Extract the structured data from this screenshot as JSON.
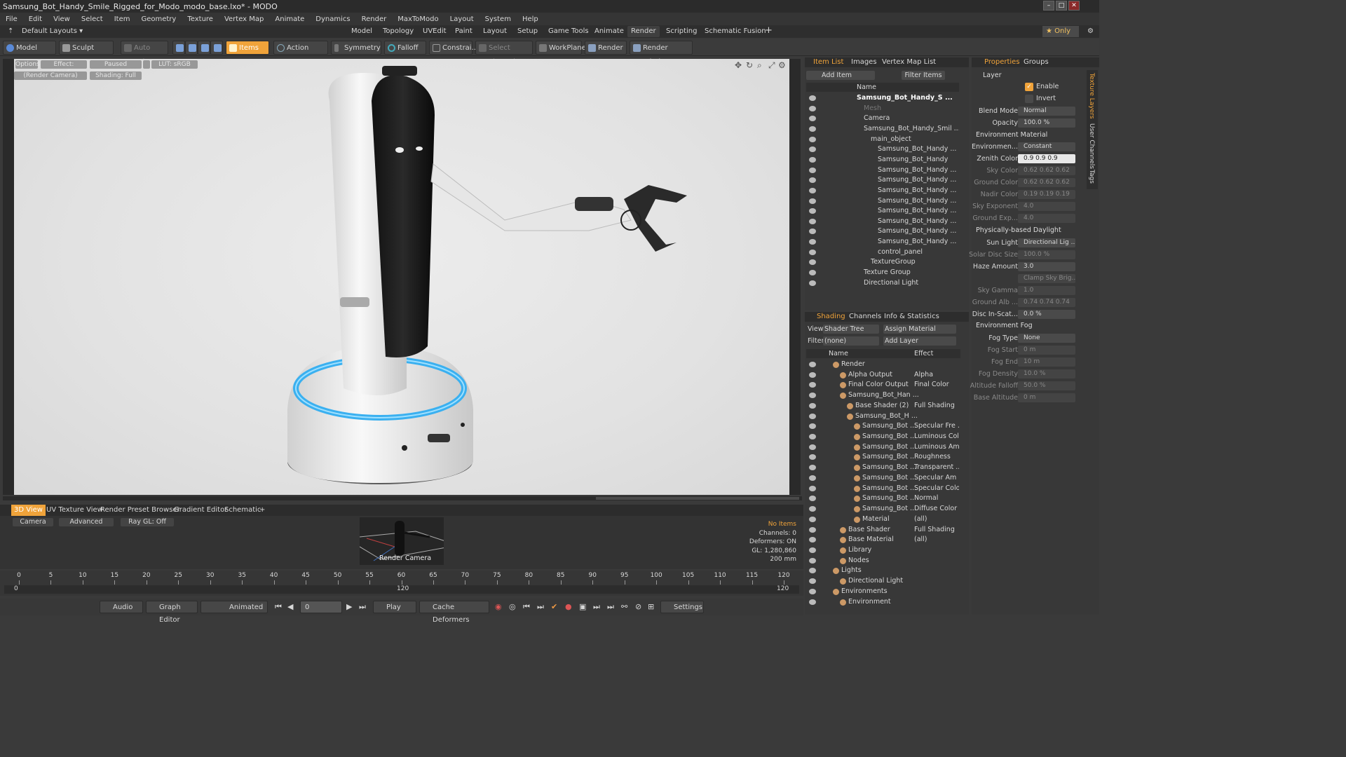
{
  "window": {
    "title": "Samsung_Bot_Handy_Smile_Rigged_for_Modo_modo_base.lxo* - MODO"
  },
  "menu": [
    "File",
    "Edit",
    "View",
    "Select",
    "Item",
    "Geometry",
    "Texture",
    "Vertex Map",
    "Animate",
    "Dynamics",
    "Render",
    "MaxToModo",
    "Layout",
    "System",
    "Help"
  ],
  "layout": {
    "preset": "Default Layouts ▾",
    "tabs": [
      "Model",
      "Topology",
      "UVEdit",
      "Paint",
      "Layout",
      "Setup",
      "Game Tools",
      "Animate",
      "Render",
      "Scripting",
      "Schematic Fusion"
    ],
    "active": "Render",
    "only": "★ Only",
    "add": "+"
  },
  "toolbar": {
    "model": "Model",
    "sculpt": "Sculpt",
    "auto_select": "Auto Select",
    "items": "Items",
    "action_center": "Action Center",
    "symmetry": "Symmetry",
    "falloff": "Falloff",
    "constrain": "Constrai...",
    "select_through": "Select Through",
    "workplane": "WorkPlane",
    "render": "Render",
    "render_window": "Render Window"
  },
  "viewport": {
    "options": "Options",
    "effect": "Effect: (Shadi...",
    "paused": "Paused",
    "lut": "LUT: sRGB",
    "camera": "(Render Camera)",
    "shading": "Shading: Full"
  },
  "item_list": {
    "tabs": [
      "Item List",
      "Images",
      "Vertex Map List"
    ],
    "add_item": "Add Item",
    "filter_items": "Filter Items",
    "col_name": "Name",
    "items": [
      {
        "label": "Samsung_Bot_Handy_S ...",
        "indent": 0,
        "bold": true
      },
      {
        "label": "Mesh",
        "indent": 1,
        "dim": true
      },
      {
        "label": "Camera",
        "indent": 1
      },
      {
        "label": "Samsung_Bot_Handy_Smil ...",
        "indent": 1
      },
      {
        "label": "main_object",
        "indent": 2
      },
      {
        "label": "Samsung_Bot_Handy ...",
        "indent": 3
      },
      {
        "label": "Samsung_Bot_Handy",
        "indent": 3
      },
      {
        "label": "Samsung_Bot_Handy ...",
        "indent": 3
      },
      {
        "label": "Samsung_Bot_Handy ...",
        "indent": 3
      },
      {
        "label": "Samsung_Bot_Handy ...",
        "indent": 3
      },
      {
        "label": "Samsung_Bot_Handy ...",
        "indent": 3
      },
      {
        "label": "Samsung_Bot_Handy ...",
        "indent": 3
      },
      {
        "label": "Samsung_Bot_Handy ...",
        "indent": 3
      },
      {
        "label": "Samsung_Bot_Handy ...",
        "indent": 3
      },
      {
        "label": "Samsung_Bot_Handy ...",
        "indent": 3
      },
      {
        "label": "control_panel",
        "indent": 3
      },
      {
        "label": "TextureGroup",
        "indent": 2
      },
      {
        "label": "Texture Group",
        "indent": 1
      },
      {
        "label": "Directional Light",
        "indent": 1
      }
    ]
  },
  "shading": {
    "tabs": [
      "Shading",
      "Channels",
      "Info & Statistics"
    ],
    "view_label": "View",
    "view_value": "Shader Tree",
    "assign": "Assign Material",
    "filter_label": "Filter",
    "filter_value": "(none)",
    "add_layer": "Add Layer",
    "col_name": "Name",
    "col_effect": "Effect",
    "rows": [
      {
        "name": "Render",
        "effect": "",
        "indent": 0
      },
      {
        "name": "Alpha Output",
        "effect": "Alpha",
        "indent": 1
      },
      {
        "name": "Final Color Output",
        "effect": "Final Color",
        "indent": 1
      },
      {
        "name": "Samsung_Bot_Han ...",
        "effect": "",
        "indent": 1
      },
      {
        "name": "Base Shader (2)",
        "effect": "Full Shading",
        "indent": 2
      },
      {
        "name": "Samsung_Bot_H ...",
        "effect": "",
        "indent": 2
      },
      {
        "name": "Samsung_Bot ...",
        "effect": "Specular Fre ...",
        "indent": 3
      },
      {
        "name": "Samsung_Bot ...",
        "effect": "Luminous Col ...",
        "indent": 3
      },
      {
        "name": "Samsung_Bot ...",
        "effect": "Luminous Am ...",
        "indent": 3
      },
      {
        "name": "Samsung_Bot ...",
        "effect": "Roughness",
        "indent": 3
      },
      {
        "name": "Samsung_Bot ...",
        "effect": "Transparent ...",
        "indent": 3
      },
      {
        "name": "Samsung_Bot ...",
        "effect": "Specular Am ...",
        "indent": 3
      },
      {
        "name": "Samsung_Bot ...",
        "effect": "Specular Color",
        "indent": 3
      },
      {
        "name": "Samsung_Bot ...",
        "effect": "Normal",
        "indent": 3
      },
      {
        "name": "Samsung_Bot ...",
        "effect": "Diffuse Color",
        "indent": 3
      },
      {
        "name": "Material",
        "effect": "(all)",
        "indent": 3
      },
      {
        "name": "Base Shader",
        "effect": "Full Shading",
        "indent": 1
      },
      {
        "name": "Base Material",
        "effect": "(all)",
        "indent": 1
      },
      {
        "name": "Library",
        "effect": "",
        "indent": 1
      },
      {
        "name": "Nodes",
        "effect": "",
        "indent": 1
      },
      {
        "name": "Lights",
        "effect": "",
        "indent": 0
      },
      {
        "name": "Directional Light",
        "effect": "",
        "indent": 1
      },
      {
        "name": "Environments",
        "effect": "",
        "indent": 0
      },
      {
        "name": "Environment",
        "effect": "",
        "indent": 1
      }
    ]
  },
  "properties": {
    "tabs": [
      "Properties",
      "Groups"
    ],
    "side_tabs": [
      "Texture Layers",
      "User Channels",
      "Tags"
    ],
    "layer": "Layer",
    "enable": "Enable",
    "invert": "Invert",
    "fields": [
      {
        "label": "Blend Mode",
        "value": "Normal"
      },
      {
        "label": "Opacity",
        "value": "100.0 %"
      }
    ],
    "env_material": "Environment Material",
    "env_fields": [
      {
        "label": "Environmen...",
        "value": "Constant",
        "dim": false
      },
      {
        "label": "Zenith Color",
        "value": "0.9   0.9   0.9",
        "dim": false,
        "light": true
      },
      {
        "label": "Sky Color",
        "value": "0.62 0.62 0.62",
        "dim": true
      },
      {
        "label": "Ground Color",
        "value": "0.62 0.62 0.62",
        "dim": true
      },
      {
        "label": "Nadir Color",
        "value": "0.19 0.19 0.19",
        "dim": true
      },
      {
        "label": "Sky Exponent",
        "value": "4.0",
        "dim": true
      },
      {
        "label": "Ground Exp...",
        "value": "4.0",
        "dim": true
      }
    ],
    "daylight": "Physically-based Daylight",
    "day_fields": [
      {
        "label": "Sun Light",
        "value": "Directional Lig ...",
        "dim": false
      },
      {
        "label": "Solar Disc Size",
        "value": "100.0 %",
        "dim": true
      },
      {
        "label": "Haze Amount",
        "value": "3.0",
        "dim": false
      },
      {
        "label": "",
        "value": "Clamp Sky Brig...",
        "dim": true
      },
      {
        "label": "Sky Gamma",
        "value": "1.0",
        "dim": true
      },
      {
        "label": "Ground Alb ...",
        "value": "0.74 0.74 0.74",
        "dim": true
      },
      {
        "label": "Disc In-Scat...",
        "value": "0.0 %",
        "dim": false
      }
    ],
    "env_fog": "Environment Fog",
    "fog_fields": [
      {
        "label": "Fog Type",
        "value": "None",
        "dim": false
      },
      {
        "label": "Fog Start",
        "value": "0 m",
        "dim": true
      },
      {
        "label": "Fog End",
        "value": "10 m",
        "dim": true
      },
      {
        "label": "Fog Density",
        "value": "10.0 %",
        "dim": true
      },
      {
        "label": "Altitude Falloff",
        "value": "50.0 %",
        "dim": true
      },
      {
        "label": "Base Altitude",
        "value": "0 m",
        "dim": true
      }
    ]
  },
  "lower": {
    "tabs": [
      "3D View",
      "UV Texture View",
      "Render Preset Browser",
      "Gradient Editor",
      "Schematic"
    ],
    "camera": "Camera",
    "advanced": "Advanced",
    "raygl": "Ray GL: Off",
    "render_camera": "Render Camera",
    "stats": [
      "No Items",
      "Channels: 0",
      "Deformers: ON",
      "GL: 1,280,860",
      "200 mm"
    ]
  },
  "timeline": {
    "ticks": [
      "0",
      "5",
      "10",
      "15",
      "20",
      "25",
      "30",
      "35",
      "40",
      "45",
      "50",
      "55",
      "60",
      "65",
      "70",
      "75",
      "80",
      "85",
      "90",
      "95",
      "100",
      "105",
      "110",
      "115",
      "120"
    ],
    "start": "0",
    "end": "120",
    "mid": "120"
  },
  "transport": {
    "audio": "Audio",
    "graph_editor": "Graph Editor",
    "animated": "Animated",
    "frame": "0",
    "play": "Play",
    "cache": "Cache Deformers",
    "settings": "Settings"
  },
  "colors": {
    "accent": "#f0a33a",
    "ring": "#3ab0f0",
    "bg": "#3a3a3a"
  }
}
